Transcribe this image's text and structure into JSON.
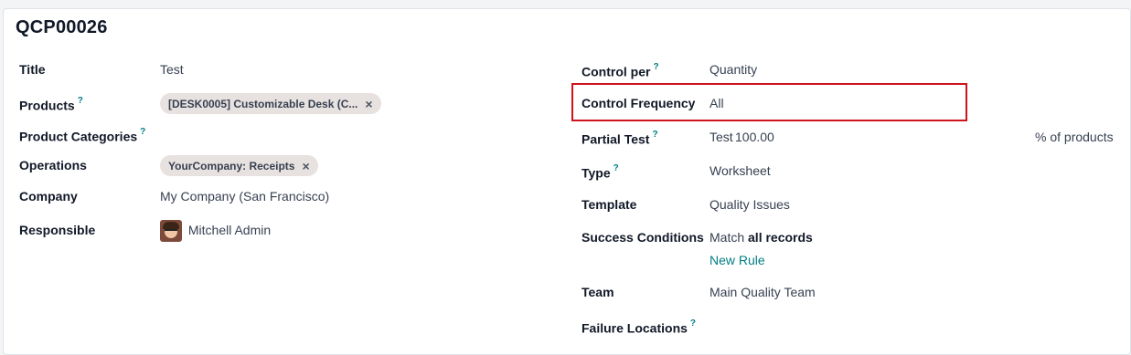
{
  "record": {
    "title": "QCP00026"
  },
  "left": {
    "title_label": "Title",
    "title_value": "Test",
    "products_label": "Products",
    "products_tag": "[DESK0005] Customizable Desk (C...",
    "product_categories_label": "Product Categories",
    "operations_label": "Operations",
    "operations_tag": "YourCompany: Receipts",
    "company_label": "Company",
    "company_value": "My Company (San Francisco)",
    "responsible_label": "Responsible",
    "responsible_value": "Mitchell Admin"
  },
  "right": {
    "control_per_label": "Control per",
    "control_per_value": "Quantity",
    "control_frequency_label": "Control Frequency",
    "control_frequency_value": "All",
    "partial_test_label": "Partial Test",
    "partial_test_value": "Test",
    "partial_test_number": "100.00",
    "partial_test_unit": "% of products",
    "type_label": "Type",
    "type_value": "Worksheet",
    "template_label": "Template",
    "template_value": "Quality Issues",
    "success_label": "Success Conditions",
    "success_prefix": "Match",
    "success_bold": "all records",
    "new_rule_label": "New Rule",
    "team_label": "Team",
    "team_value": "Main Quality Team",
    "failure_label": "Failure Locations"
  },
  "help_marker": "?",
  "remove_marker": "×",
  "colors": {
    "accent": "#017e84",
    "highlight": "#d0121b",
    "tag_bg": "#e7e1df"
  }
}
